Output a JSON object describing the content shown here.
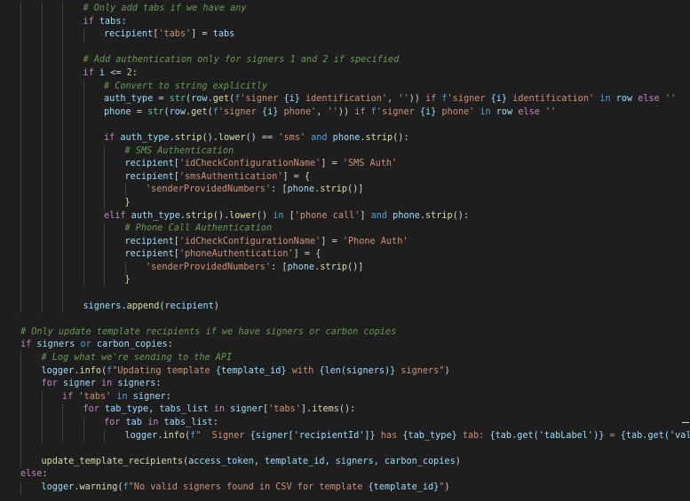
{
  "colors": {
    "background": "#1e1e1e",
    "text": "#d4d4d4",
    "keyword": "#c586c0",
    "comment": "#6a9955",
    "string": "#ce9178",
    "function": "#dcdcaa",
    "variable": "#9cdcfe",
    "builtin": "#4ec9b0",
    "constant": "#569cd6",
    "number": "#b5cea8"
  },
  "code_lines": [
    {
      "indent": 3,
      "tokens": [
        {
          "t": "# Only add tabs if we have any",
          "c": "comment"
        }
      ]
    },
    {
      "indent": 3,
      "tokens": [
        {
          "t": "if",
          "c": "keyword"
        },
        {
          "t": " tabs:",
          "c": "variable"
        }
      ]
    },
    {
      "indent": 4,
      "tokens": [
        {
          "t": "recipient",
          "c": "variable"
        },
        {
          "t": "[",
          "c": "text"
        },
        {
          "t": "'tabs'",
          "c": "string"
        },
        {
          "t": "] = ",
          "c": "text"
        },
        {
          "t": "tabs",
          "c": "variable"
        }
      ]
    },
    {
      "indent": 3,
      "tokens": []
    },
    {
      "indent": 3,
      "tokens": [
        {
          "t": "# Add authentication only for signers 1 and 2 if specified",
          "c": "comment"
        }
      ]
    },
    {
      "indent": 3,
      "tokens": [
        {
          "t": "if",
          "c": "keyword"
        },
        {
          "t": " i ",
          "c": "variable"
        },
        {
          "t": "<= ",
          "c": "text"
        },
        {
          "t": "2",
          "c": "number"
        },
        {
          "t": ":",
          "c": "text"
        }
      ]
    },
    {
      "indent": 4,
      "tokens": [
        {
          "t": "# Convert to string explicitly",
          "c": "comment"
        }
      ]
    },
    {
      "indent": 4,
      "tokens": [
        {
          "t": "auth_type",
          "c": "variable"
        },
        {
          "t": " = ",
          "c": "text"
        },
        {
          "t": "str",
          "c": "builtin"
        },
        {
          "t": "(",
          "c": "text"
        },
        {
          "t": "row",
          "c": "variable"
        },
        {
          "t": ".",
          "c": "text"
        },
        {
          "t": "get",
          "c": "function"
        },
        {
          "t": "(",
          "c": "text"
        },
        {
          "t": "f",
          "c": "constant"
        },
        {
          "t": "'signer ",
          "c": "string"
        },
        {
          "t": "{i}",
          "c": "variable"
        },
        {
          "t": " identification'",
          "c": "string"
        },
        {
          "t": ", ",
          "c": "text"
        },
        {
          "t": "''",
          "c": "string"
        },
        {
          "t": ")) ",
          "c": "text"
        },
        {
          "t": "if",
          "c": "keyword"
        },
        {
          "t": " ",
          "c": "text"
        },
        {
          "t": "f",
          "c": "constant"
        },
        {
          "t": "'signer ",
          "c": "string"
        },
        {
          "t": "{i}",
          "c": "variable"
        },
        {
          "t": " identification' ",
          "c": "string"
        },
        {
          "t": "in",
          "c": "constant"
        },
        {
          "t": " row ",
          "c": "variable"
        },
        {
          "t": "else",
          "c": "keyword"
        },
        {
          "t": " ''",
          "c": "string"
        }
      ]
    },
    {
      "indent": 4,
      "tokens": [
        {
          "t": "phone",
          "c": "variable"
        },
        {
          "t": " = ",
          "c": "text"
        },
        {
          "t": "str",
          "c": "builtin"
        },
        {
          "t": "(",
          "c": "text"
        },
        {
          "t": "row",
          "c": "variable"
        },
        {
          "t": ".",
          "c": "text"
        },
        {
          "t": "get",
          "c": "function"
        },
        {
          "t": "(",
          "c": "text"
        },
        {
          "t": "f",
          "c": "constant"
        },
        {
          "t": "'signer ",
          "c": "string"
        },
        {
          "t": "{i}",
          "c": "variable"
        },
        {
          "t": " phone'",
          "c": "string"
        },
        {
          "t": ", ",
          "c": "text"
        },
        {
          "t": "''",
          "c": "string"
        },
        {
          "t": ")) ",
          "c": "text"
        },
        {
          "t": "if",
          "c": "keyword"
        },
        {
          "t": " ",
          "c": "text"
        },
        {
          "t": "f",
          "c": "constant"
        },
        {
          "t": "'signer ",
          "c": "string"
        },
        {
          "t": "{i}",
          "c": "variable"
        },
        {
          "t": " phone' ",
          "c": "string"
        },
        {
          "t": "in",
          "c": "constant"
        },
        {
          "t": " row ",
          "c": "variable"
        },
        {
          "t": "else",
          "c": "keyword"
        },
        {
          "t": " ''",
          "c": "string"
        }
      ]
    },
    {
      "indent": 4,
      "tokens": []
    },
    {
      "indent": 4,
      "tokens": [
        {
          "t": "if",
          "c": "keyword"
        },
        {
          "t": " auth_type",
          "c": "variable"
        },
        {
          "t": ".",
          "c": "text"
        },
        {
          "t": "strip",
          "c": "function"
        },
        {
          "t": "().",
          "c": "text"
        },
        {
          "t": "lower",
          "c": "function"
        },
        {
          "t": "() == ",
          "c": "text"
        },
        {
          "t": "'sms'",
          "c": "string"
        },
        {
          "t": " ",
          "c": "text"
        },
        {
          "t": "and",
          "c": "constant"
        },
        {
          "t": " phone",
          "c": "variable"
        },
        {
          "t": ".",
          "c": "text"
        },
        {
          "t": "strip",
          "c": "function"
        },
        {
          "t": "():",
          "c": "text"
        }
      ]
    },
    {
      "indent": 5,
      "tokens": [
        {
          "t": "# SMS Authentication",
          "c": "comment"
        }
      ]
    },
    {
      "indent": 5,
      "tokens": [
        {
          "t": "recipient",
          "c": "variable"
        },
        {
          "t": "[",
          "c": "text"
        },
        {
          "t": "'idCheckConfigurationName'",
          "c": "string"
        },
        {
          "t": "] = ",
          "c": "text"
        },
        {
          "t": "'SMS Auth'",
          "c": "string"
        }
      ]
    },
    {
      "indent": 5,
      "tokens": [
        {
          "t": "recipient",
          "c": "variable"
        },
        {
          "t": "[",
          "c": "text"
        },
        {
          "t": "'smsAuthentication'",
          "c": "string"
        },
        {
          "t": "] = {",
          "c": "text"
        }
      ]
    },
    {
      "indent": 6,
      "tokens": [
        {
          "t": "'senderProvidedNumbers'",
          "c": "string"
        },
        {
          "t": ": [",
          "c": "text"
        },
        {
          "t": "phone",
          "c": "variable"
        },
        {
          "t": ".",
          "c": "text"
        },
        {
          "t": "strip",
          "c": "function"
        },
        {
          "t": "()]",
          "c": "text"
        }
      ]
    },
    {
      "indent": 5,
      "tokens": [
        {
          "t": "}",
          "c": "function"
        }
      ]
    },
    {
      "indent": 4,
      "tokens": [
        {
          "t": "elif",
          "c": "keyword"
        },
        {
          "t": " auth_type",
          "c": "variable"
        },
        {
          "t": ".",
          "c": "text"
        },
        {
          "t": "strip",
          "c": "function"
        },
        {
          "t": "().",
          "c": "text"
        },
        {
          "t": "lower",
          "c": "function"
        },
        {
          "t": "() ",
          "c": "text"
        },
        {
          "t": "in",
          "c": "constant"
        },
        {
          "t": " [",
          "c": "text"
        },
        {
          "t": "'phone call'",
          "c": "string"
        },
        {
          "t": "] ",
          "c": "text"
        },
        {
          "t": "and",
          "c": "constant"
        },
        {
          "t": " phone",
          "c": "variable"
        },
        {
          "t": ".",
          "c": "text"
        },
        {
          "t": "strip",
          "c": "function"
        },
        {
          "t": "():",
          "c": "text"
        }
      ]
    },
    {
      "indent": 5,
      "tokens": [
        {
          "t": "# Phone Call Authentication",
          "c": "comment"
        }
      ]
    },
    {
      "indent": 5,
      "tokens": [
        {
          "t": "recipient",
          "c": "variable"
        },
        {
          "t": "[",
          "c": "text"
        },
        {
          "t": "'idCheckConfigurationName'",
          "c": "string"
        },
        {
          "t": "] = ",
          "c": "text"
        },
        {
          "t": "'Phone Auth'",
          "c": "string"
        }
      ]
    },
    {
      "indent": 5,
      "tokens": [
        {
          "t": "recipient",
          "c": "variable"
        },
        {
          "t": "[",
          "c": "text"
        },
        {
          "t": "'phoneAuthentication'",
          "c": "string"
        },
        {
          "t": "] = {",
          "c": "text"
        }
      ]
    },
    {
      "indent": 6,
      "tokens": [
        {
          "t": "'senderProvidedNumbers'",
          "c": "string"
        },
        {
          "t": ": [",
          "c": "text"
        },
        {
          "t": "phone",
          "c": "variable"
        },
        {
          "t": ".",
          "c": "text"
        },
        {
          "t": "strip",
          "c": "function"
        },
        {
          "t": "()]",
          "c": "text"
        }
      ]
    },
    {
      "indent": 5,
      "tokens": [
        {
          "t": "}",
          "c": "function"
        }
      ]
    },
    {
      "indent": 3,
      "tokens": []
    },
    {
      "indent": 3,
      "tokens": [
        {
          "t": "signers",
          "c": "variable"
        },
        {
          "t": ".",
          "c": "text"
        },
        {
          "t": "append",
          "c": "function"
        },
        {
          "t": "(",
          "c": "text"
        },
        {
          "t": "recipient",
          "c": "variable"
        },
        {
          "t": ")",
          "c": "text"
        }
      ]
    },
    {
      "indent": 0,
      "tokens": []
    },
    {
      "indent": 0,
      "tokens": [
        {
          "t": "# Only update template recipients if we have signers or carbon copies",
          "c": "comment"
        }
      ]
    },
    {
      "indent": 0,
      "tokens": [
        {
          "t": "if",
          "c": "keyword"
        },
        {
          "t": " signers ",
          "c": "variable"
        },
        {
          "t": "or",
          "c": "constant"
        },
        {
          "t": " carbon_copies",
          "c": "variable"
        },
        {
          "t": ":",
          "c": "text"
        }
      ]
    },
    {
      "indent": 1,
      "tokens": [
        {
          "t": "# Log what we're sending to the API",
          "c": "comment"
        }
      ]
    },
    {
      "indent": 1,
      "tokens": [
        {
          "t": "logger",
          "c": "variable"
        },
        {
          "t": ".",
          "c": "text"
        },
        {
          "t": "info",
          "c": "function"
        },
        {
          "t": "(",
          "c": "text"
        },
        {
          "t": "f",
          "c": "constant"
        },
        {
          "t": "\"Updating template ",
          "c": "string"
        },
        {
          "t": "{template_id}",
          "c": "variable"
        },
        {
          "t": " with ",
          "c": "string"
        },
        {
          "t": "{len(signers)}",
          "c": "variable"
        },
        {
          "t": " signers\"",
          "c": "string"
        },
        {
          "t": ")",
          "c": "text"
        }
      ]
    },
    {
      "indent": 1,
      "tokens": [
        {
          "t": "for",
          "c": "keyword"
        },
        {
          "t": " signer ",
          "c": "variable"
        },
        {
          "t": "in",
          "c": "keyword"
        },
        {
          "t": " signers",
          "c": "variable"
        },
        {
          "t": ":",
          "c": "text"
        }
      ]
    },
    {
      "indent": 2,
      "tokens": [
        {
          "t": "if",
          "c": "keyword"
        },
        {
          "t": " ",
          "c": "text"
        },
        {
          "t": "'tabs'",
          "c": "string"
        },
        {
          "t": " ",
          "c": "text"
        },
        {
          "t": "in",
          "c": "constant"
        },
        {
          "t": " signer",
          "c": "variable"
        },
        {
          "t": ":",
          "c": "text"
        }
      ]
    },
    {
      "indent": 3,
      "tokens": [
        {
          "t": "for",
          "c": "keyword"
        },
        {
          "t": " tab_type",
          "c": "variable"
        },
        {
          "t": ", ",
          "c": "text"
        },
        {
          "t": "tabs_list",
          "c": "variable"
        },
        {
          "t": " ",
          "c": "text"
        },
        {
          "t": "in",
          "c": "keyword"
        },
        {
          "t": " signer",
          "c": "variable"
        },
        {
          "t": "[",
          "c": "text"
        },
        {
          "t": "'tabs'",
          "c": "string"
        },
        {
          "t": "].",
          "c": "text"
        },
        {
          "t": "items",
          "c": "function"
        },
        {
          "t": "():",
          "c": "text"
        }
      ]
    },
    {
      "indent": 4,
      "tokens": [
        {
          "t": "for",
          "c": "keyword"
        },
        {
          "t": " tab ",
          "c": "variable"
        },
        {
          "t": "in",
          "c": "keyword"
        },
        {
          "t": " tabs_list",
          "c": "variable"
        },
        {
          "t": ":",
          "c": "text"
        }
      ]
    },
    {
      "indent": 5,
      "tokens": [
        {
          "t": "logger",
          "c": "variable"
        },
        {
          "t": ".",
          "c": "text"
        },
        {
          "t": "info",
          "c": "function"
        },
        {
          "t": "(",
          "c": "text"
        },
        {
          "t": "f",
          "c": "constant"
        },
        {
          "t": "\"  Signer ",
          "c": "string"
        },
        {
          "t": "{signer['recipientId']}",
          "c": "variable"
        },
        {
          "t": " has ",
          "c": "string"
        },
        {
          "t": "{tab_type}",
          "c": "variable"
        },
        {
          "t": " tab: ",
          "c": "string"
        },
        {
          "t": "{tab.get('tabLabel')}",
          "c": "variable"
        },
        {
          "t": " = ",
          "c": "string"
        },
        {
          "t": "{tab.get('value')}",
          "c": "variable"
        }
      ]
    },
    {
      "indent": 1,
      "tokens": []
    },
    {
      "indent": 1,
      "tokens": [
        {
          "t": "update_template_recipients",
          "c": "function"
        },
        {
          "t": "(",
          "c": "text"
        },
        {
          "t": "access_token",
          "c": "variable"
        },
        {
          "t": ", ",
          "c": "text"
        },
        {
          "t": "template_id",
          "c": "variable"
        },
        {
          "t": ", ",
          "c": "text"
        },
        {
          "t": "signers",
          "c": "variable"
        },
        {
          "t": ", ",
          "c": "text"
        },
        {
          "t": "carbon_copies",
          "c": "variable"
        },
        {
          "t": ")",
          "c": "text"
        }
      ]
    },
    {
      "indent": 0,
      "tokens": [
        {
          "t": "else",
          "c": "keyword"
        },
        {
          "t": ":",
          "c": "text"
        }
      ]
    },
    {
      "indent": 1,
      "tokens": [
        {
          "t": "logger",
          "c": "variable"
        },
        {
          "t": ".",
          "c": "text"
        },
        {
          "t": "warning",
          "c": "function"
        },
        {
          "t": "(",
          "c": "text"
        },
        {
          "t": "f",
          "c": "constant"
        },
        {
          "t": "\"No valid signers found in CSV for template ",
          "c": "string"
        },
        {
          "t": "{template_id}",
          "c": "variable"
        },
        {
          "t": "\"",
          "c": "string"
        },
        {
          "t": ")",
          "c": "text"
        }
      ]
    }
  ]
}
